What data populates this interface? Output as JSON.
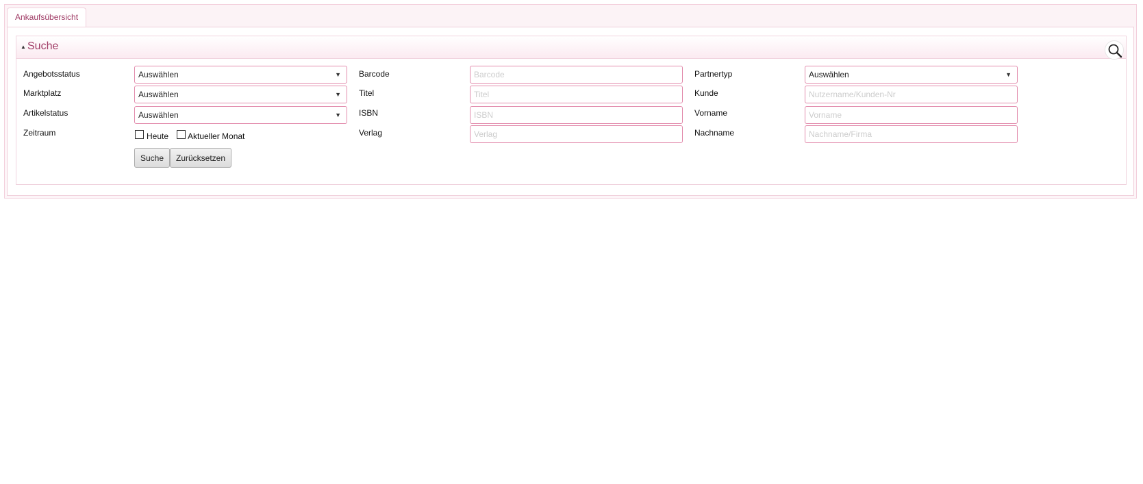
{
  "tabs": [
    {
      "label": "Ankaufsübersicht"
    }
  ],
  "search_section": {
    "title": "Suche",
    "search_icon": "magnifier-icon",
    "collapse_icon": "triangle-up-icon"
  },
  "form": {
    "col1": {
      "angebotsstatus": {
        "label": "Angebotsstatus",
        "value": "Auswählen"
      },
      "marktplatz": {
        "label": "Marktplatz",
        "value": "Auswählen"
      },
      "artikelstatus": {
        "label": "Artikelstatus",
        "value": "Auswählen"
      },
      "zeitraum": {
        "label": "Zeitraum",
        "option_heute": "Heute",
        "option_monat": "Aktueller Monat"
      }
    },
    "col2": {
      "barcode": {
        "label": "Barcode",
        "placeholder": "Barcode"
      },
      "titel": {
        "label": "Titel",
        "placeholder": "Titel"
      },
      "isbn": {
        "label": "ISBN",
        "placeholder": "ISBN"
      },
      "verlag": {
        "label": "Verlag",
        "placeholder": "Verlag"
      }
    },
    "col3": {
      "partnertyp": {
        "label": "Partnertyp",
        "value": "Auswählen"
      },
      "kunde": {
        "label": "Kunde",
        "placeholder": "Nutzername/Kunden-Nr"
      },
      "vorname": {
        "label": "Vorname",
        "placeholder": "Vorname"
      },
      "nachname": {
        "label": "Nachname",
        "placeholder": "Nachname/Firma"
      }
    }
  },
  "buttons": {
    "search": "Suche",
    "reset": "Zurücksetzen"
  },
  "colors": {
    "accent": "#a03c66",
    "field_border": "#e28aab",
    "panel_border": "#f0cfdb"
  }
}
